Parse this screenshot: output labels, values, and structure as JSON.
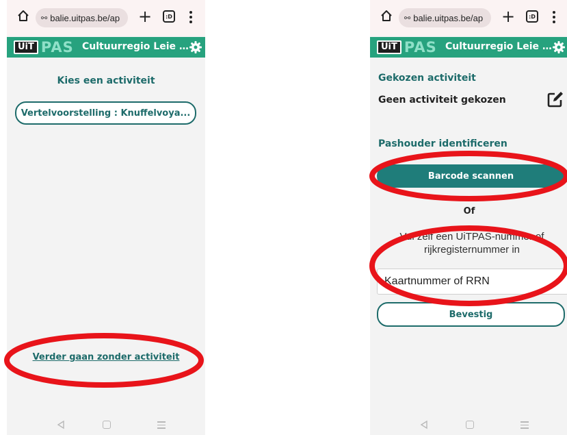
{
  "browser": {
    "url_text": "balie.uitpas.be/ap",
    "url_icon": "⚯",
    "plus_label": "+",
    "tabs_label": ":D"
  },
  "app": {
    "logo_uit": "UiT",
    "logo_pas": "PAS",
    "title": "Cultuurregio Leie Sc...",
    "header_color": "#27a27e",
    "accent_color": "#1d6b6a"
  },
  "left_screen": {
    "heading": "Kies een activiteit",
    "activity_button": "Vertelvoorstelling : Knuffelvoya...",
    "continue_link": "Verder gaan zonder activiteit"
  },
  "right_screen": {
    "chosen_title": "Gekozen activiteit",
    "chosen_value": "Geen activiteit gekozen",
    "identify_title": "Pashouder identificeren",
    "scan_button": "Barcode scannen",
    "or_text": "Of",
    "info_text": "Vul zelf een UiTPAS-nummer of rijkregisternummer in",
    "input_placeholder": "Kaartnummer of RRN",
    "confirm_button": "Bevestig"
  },
  "icons": {
    "home": "home-icon",
    "settings": "gear-icon",
    "edit": "edit-icon",
    "menu": "more-vertical-icon",
    "nav_back": "nav-back-icon",
    "nav_home": "nav-home-icon",
    "nav_recent": "nav-recent-icon"
  },
  "annotation_color": "#e8141a"
}
